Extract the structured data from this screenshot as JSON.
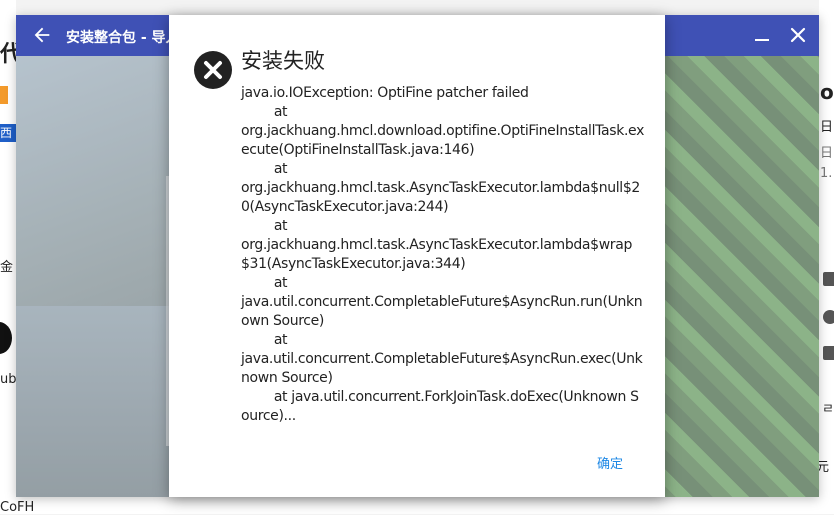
{
  "window": {
    "title": "安装整合包 - 导入"
  },
  "dialog": {
    "title": "安装失败",
    "message": "java.io.IOException: OptiFine patcher failed\n\tat\norg.jackhuang.hmcl.download.optifine.OptiFineInstallTask.execute(OptiFineInstallTask.java:146)\n\tat\norg.jackhuang.hmcl.task.AsyncTaskExecutor.lambda$null$20(AsyncTaskExecutor.java:244)\n\tat\norg.jackhuang.hmcl.task.AsyncTaskExecutor.lambda$wrap$31(AsyncTaskExecutor.java:344)\n\tat\njava.util.concurrent.CompletableFuture$AsyncRun.run(Unknown Source)\n\tat\njava.util.concurrent.CompletableFuture$AsyncRun.exec(Unknown Source)\n\tat java.util.concurrent.ForkJoinTask.doExec(Unknown Source)...",
    "ok_label": "确定"
  },
  "background_fragments": {
    "left_top": "代",
    "left_blue": "西",
    "left_mid": "金",
    "left_low": "ub",
    "bottom_left": "CoFH",
    "right_1": "o",
    "right_2": "日",
    "right_3": "日",
    "right_4": "1.",
    "right_5": "ㄹ",
    "right_6": "元"
  },
  "colors": {
    "titlebar": "#3f51b5",
    "accent": "#1e88e5",
    "error_icon": "#222222"
  },
  "icons": {
    "back": "arrow-left-icon",
    "minimize": "minimize-icon",
    "close": "close-icon",
    "error": "error-circle-icon"
  }
}
